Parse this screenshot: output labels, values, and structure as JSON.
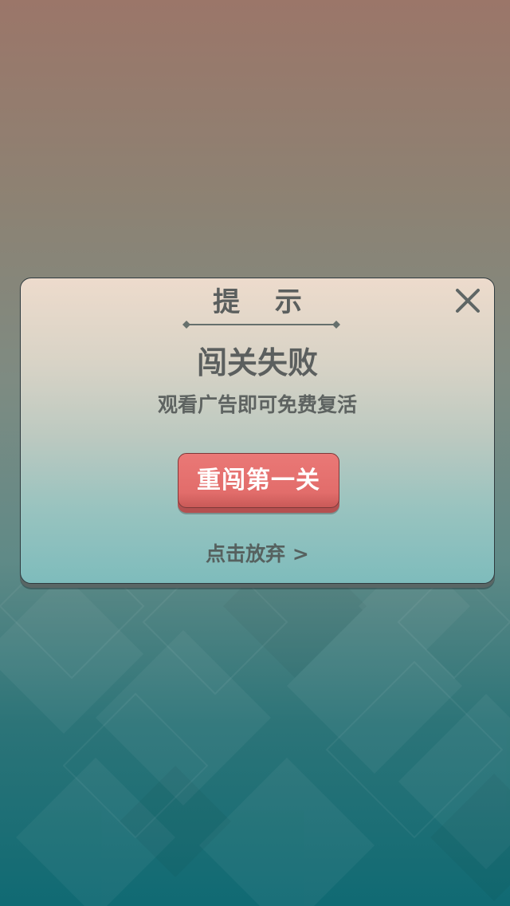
{
  "dialog": {
    "title": "提 示",
    "headline": "闯关失败",
    "subtitle": "观看广告即可免费复活",
    "primary_button_label": "重闯第一关",
    "give_up_label": "点击放弃 >"
  },
  "icons": {
    "close": "close-icon"
  },
  "colors": {
    "primary_button": "#e26d6b",
    "text": "#5b5f5e",
    "dialog_top": "#eddbcc",
    "dialog_bottom": "#7ebcbc"
  }
}
